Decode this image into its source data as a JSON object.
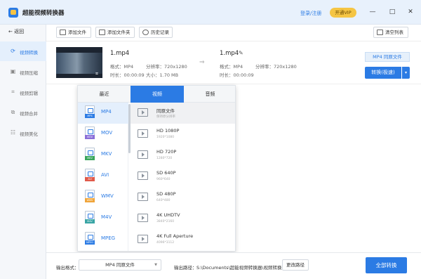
{
  "app": {
    "title": "超能视频转换器",
    "login_label": "登录/注册",
    "vip_label": "开通VIP",
    "controls": {
      "minimize": "—",
      "maximize": "□",
      "close": "✕"
    }
  },
  "sidebar": {
    "back_label": "返回",
    "items": [
      {
        "label": "视频转换",
        "icon": "convert-icon",
        "glyph": "⟳",
        "active": true
      },
      {
        "label": "视频压缩",
        "icon": "compress-icon",
        "glyph": "▣",
        "active": false
      },
      {
        "label": "视频剪辑",
        "icon": "cut-icon",
        "glyph": "⌗",
        "active": false
      },
      {
        "label": "视频合并",
        "icon": "merge-icon",
        "glyph": "⧉",
        "active": false
      },
      {
        "label": "视频美化",
        "icon": "beautify-icon",
        "glyph": "☷",
        "active": false
      }
    ]
  },
  "toolbar": {
    "add_file": "添加文件",
    "add_folder": "添加文件夹",
    "history": "历史记录",
    "clear_list": "清空列表"
  },
  "file": {
    "source_name": "1.mp4",
    "source_format": "格式：MP4",
    "source_resolution": "分辨率：720x1280",
    "source_duration": "时长：00:00:09",
    "source_size": "大小：1.70 MB",
    "target_name": "1.mp4",
    "target_format": "格式：MP4",
    "target_resolution": "分辨率：720x1280",
    "target_duration": "时长：00:00:09",
    "output_format_label": "MP4 同原文件",
    "convert_label": "转换(极速)",
    "convert_dropdown": "▾"
  },
  "format_panel": {
    "tabs": [
      "最近",
      "视频",
      "音频"
    ],
    "active_tab": 1,
    "formats": [
      {
        "label": "MP4",
        "tag": "MP4",
        "tag_color": "#2b7be4"
      },
      {
        "label": "MOV",
        "tag": "MOV",
        "tag_color": "#8a6fd8"
      },
      {
        "label": "MKV",
        "tag": "MKV",
        "tag_color": "#3aa55c"
      },
      {
        "label": "AVI",
        "tag": "AVI",
        "tag_color": "#e05a4a"
      },
      {
        "label": "WMV",
        "tag": "WMV",
        "tag_color": "#f0a53a"
      },
      {
        "label": "M4V",
        "tag": "M4V",
        "tag_color": "#3aa5a5"
      },
      {
        "label": "MPEG",
        "tag": "MPEG",
        "tag_color": "#2b7be4"
      }
    ],
    "options": [
      {
        "name": "同原文件",
        "res": "保持原分辨率"
      },
      {
        "name": "HD 1080P",
        "res": "1920*1080"
      },
      {
        "name": "HD 720P",
        "res": "1280*720"
      },
      {
        "name": "SD 640P",
        "res": "960*640"
      },
      {
        "name": "SD 480P",
        "res": "640*480"
      },
      {
        "name": "4K UHDTV",
        "res": "3840*2160"
      },
      {
        "name": "4K Full Aperture",
        "res": "4096*3112"
      }
    ]
  },
  "bottom": {
    "output_format_label": "输出格式：",
    "output_format_value": "MP4 同原文件",
    "output_path_label": "输出路径：",
    "output_path_value": "S:\\Documents\\超能视频转换器\\视频转换",
    "change_path": "更改路径",
    "convert_all": "全部转换"
  }
}
